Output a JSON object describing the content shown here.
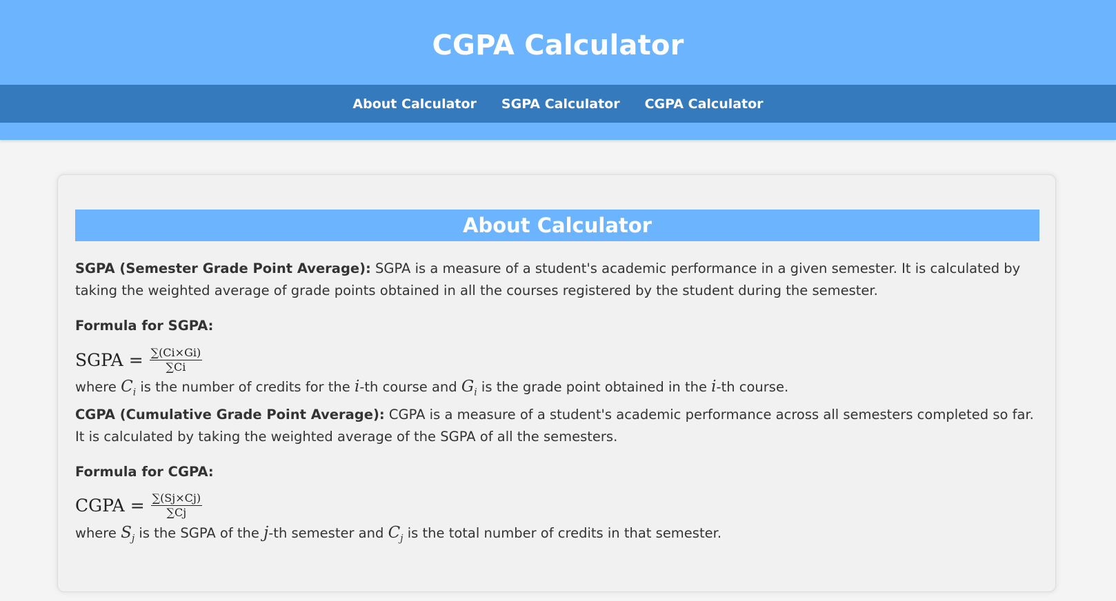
{
  "header": {
    "title": "CGPA Calculator"
  },
  "nav": {
    "items": [
      {
        "label": "About Calculator"
      },
      {
        "label": "SGPA Calculator"
      },
      {
        "label": "CGPA Calculator"
      }
    ]
  },
  "about": {
    "title": "About Calculator",
    "sgpa_lead": "SGPA (Semester Grade Point Average):",
    "sgpa_text": " SGPA is a measure of a student's academic performance in a given semester. It is calculated by taking the weighted average of grade points obtained in all the courses registered by the student during the semester.",
    "sgpa_formula_heading": "Formula for SGPA:",
    "sgpa_formula": {
      "lhs": "SGPA",
      "eq": "=",
      "numerator": "∑(Ci×Gi)",
      "denominator": "∑Ci"
    },
    "sgpa_where": {
      "t1": "where ",
      "v1": "C",
      "v1_sub": "i",
      "t2": " is the number of credits for the ",
      "v2": "i",
      "t3": "-th course and ",
      "v3": "G",
      "v3_sub": "i",
      "t4": " is the grade point obtained in the ",
      "v4": "i",
      "t5": "-th course."
    },
    "cgpa_lead": "CGPA (Cumulative Grade Point Average):",
    "cgpa_text": " CGPA is a measure of a student's academic performance across all semesters completed so far. It is calculated by taking the weighted average of the SGPA of all the semesters.",
    "cgpa_formula_heading": "Formula for CGPA:",
    "cgpa_formula": {
      "lhs": "CGPA",
      "eq": "=",
      "numerator": "∑(Sj×Cj)",
      "denominator": "∑Cj"
    },
    "cgpa_where": {
      "t1": "where ",
      "v1": "S",
      "v1_sub": "j",
      "t2": " is the SGPA of the ",
      "v2": "j",
      "t3": "-th semester and ",
      "v3": "C",
      "v3_sub": "j",
      "t4": " is the total number of credits in that semester."
    }
  },
  "colors": {
    "header_bg": "#6cb4fd",
    "nav_bg": "#357abd",
    "page_bg": "#f4f4f4",
    "card_bg": "#f1f1f1"
  }
}
